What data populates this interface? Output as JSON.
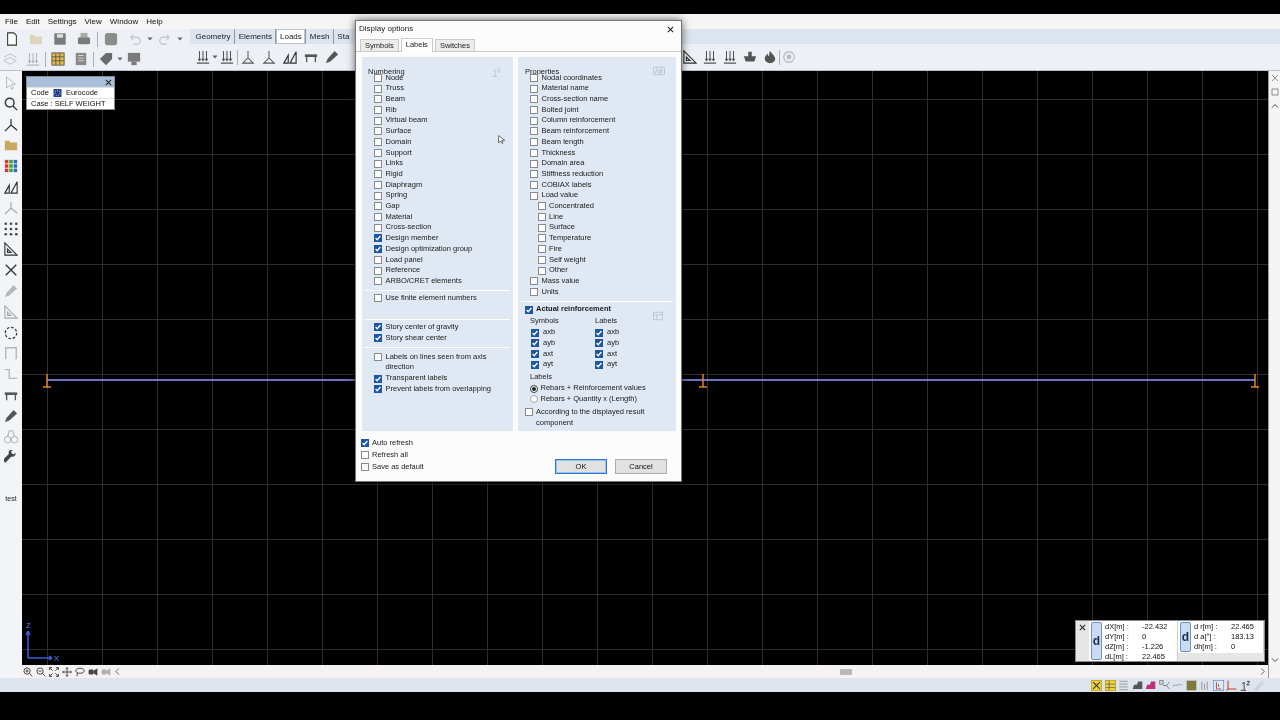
{
  "menu_bar": [
    "File",
    "Edit",
    "Settings",
    "View",
    "Window",
    "Help"
  ],
  "ribbon_tabs": [
    {
      "label": "Geometry",
      "selected": false
    },
    {
      "label": "Elements",
      "selected": false
    },
    {
      "label": "Loads",
      "selected": true
    },
    {
      "label": "Mesh",
      "selected": false
    },
    {
      "label": "Sta",
      "selected": false
    }
  ],
  "info_box": {
    "code_label": "Code",
    "code_value": "Eurocode",
    "case": "Case : SELF WEIGHT"
  },
  "dialog": {
    "title": "Display options",
    "tabs": [
      {
        "label": "Symbols",
        "selected": false
      },
      {
        "label": "Labels",
        "selected": true
      },
      {
        "label": "Switches",
        "selected": false
      }
    ],
    "numbering": {
      "heading": "Numbering",
      "items": [
        {
          "label": "Node",
          "checked": false
        },
        {
          "label": "Truss",
          "checked": false
        },
        {
          "label": "Beam",
          "checked": false
        },
        {
          "label": "Rib",
          "checked": false
        },
        {
          "label": "Virtual beam",
          "checked": false
        },
        {
          "label": "Surface",
          "checked": false
        },
        {
          "label": "Domain",
          "checked": false
        },
        {
          "label": "Support",
          "checked": false
        },
        {
          "label": "Links",
          "checked": false
        },
        {
          "label": "Rigid",
          "checked": false
        },
        {
          "label": "Diaphragm",
          "checked": false
        },
        {
          "label": "Spring",
          "checked": false
        },
        {
          "label": "Gap",
          "checked": false
        },
        {
          "label": "Material",
          "checked": false
        },
        {
          "label": "Cross-section",
          "checked": false
        },
        {
          "label": "Design member",
          "checked": true
        },
        {
          "label": "Design optimization group",
          "checked": true
        },
        {
          "label": "Load panel",
          "checked": false
        },
        {
          "label": "Reference",
          "checked": false
        },
        {
          "label": "ARBO/CRET elements",
          "checked": false
        }
      ],
      "finite_element": {
        "label": "Use finite element numbers",
        "checked": false
      },
      "story": [
        {
          "label": "Story center of gravity",
          "checked": true
        },
        {
          "label": "Story shear center",
          "checked": true
        }
      ],
      "display": [
        {
          "label": "Labels on lines seen from axis direction",
          "checked": false
        },
        {
          "label": "Transparent labels",
          "checked": true
        },
        {
          "label": "Prevent labels from overlapping",
          "checked": true
        }
      ]
    },
    "properties": {
      "heading": "Properties",
      "items": [
        {
          "label": "Nodal coordinates",
          "checked": false
        },
        {
          "label": "Material name",
          "checked": false
        },
        {
          "label": "Cross-section name",
          "checked": false
        },
        {
          "label": "Bolted joint",
          "checked": false
        },
        {
          "label": "Column reinforcement",
          "checked": false
        },
        {
          "label": "Beam reinforcement",
          "checked": false
        },
        {
          "label": "Beam length",
          "checked": false
        },
        {
          "label": "Thickness",
          "checked": false
        },
        {
          "label": "Domain area",
          "checked": false
        },
        {
          "label": "Stiffness reduction",
          "checked": false
        },
        {
          "label": "COBIAX labels",
          "checked": false
        },
        {
          "label": "Load value",
          "checked": false,
          "children": [
            {
              "label": "Concentrated",
              "checked": false
            },
            {
              "label": "Line",
              "checked": false
            },
            {
              "label": "Surface",
              "checked": false
            },
            {
              "label": "Temperature",
              "checked": false
            },
            {
              "label": "Fire",
              "checked": false
            },
            {
              "label": "Self weight",
              "checked": false
            },
            {
              "label": "Other",
              "checked": false
            }
          ]
        },
        {
          "label": "Mass value",
          "checked": false
        },
        {
          "label": "Units",
          "checked": false
        }
      ]
    },
    "actual_reinforcement": {
      "label": "Actual reinforcement",
      "checked": true,
      "symbols_heading": "Symbols",
      "labels_heading": "Labels",
      "symbols": [
        {
          "label": "axb",
          "checked": true
        },
        {
          "label": "ayb",
          "checked": true
        },
        {
          "label": "axt",
          "checked": true
        },
        {
          "label": "ayt",
          "checked": true
        }
      ],
      "labels": [
        {
          "label": "axb",
          "checked": true
        },
        {
          "label": "ayb",
          "checked": true
        },
        {
          "label": "axt",
          "checked": true
        },
        {
          "label": "ayt",
          "checked": true
        }
      ],
      "mode_heading": "Labels",
      "modes": [
        {
          "label": "Rebars + Reinforcement values",
          "selected": true
        },
        {
          "label": "Rebars + Quantity x (Length)",
          "selected": false
        }
      ],
      "result_component": {
        "label": "According to the displayed result component",
        "checked": false
      }
    },
    "options": [
      {
        "label": "Auto refresh",
        "checked": true
      },
      {
        "label": "Refresh all",
        "checked": false
      },
      {
        "label": "Save as default",
        "checked": false
      }
    ],
    "buttons": [
      {
        "label": "OK",
        "kind": "default"
      },
      {
        "label": "Cancel",
        "kind": "normal"
      }
    ]
  },
  "side_toolbar_label": "test",
  "viewport": {
    "axis_labels": {
      "z": "Z",
      "x": "X"
    }
  },
  "measure_box": {
    "groups": [
      {
        "letter": "d",
        "rows": [
          {
            "label": "dX[m] :",
            "value": "-22.432"
          },
          {
            "label": "dY[m] :",
            "value": "0"
          },
          {
            "label": "dZ[m] :",
            "value": "-1.226"
          },
          {
            "label": "dL[m] :",
            "value": "22.465"
          }
        ]
      },
      {
        "letter": "d",
        "rows": [
          {
            "label": "d r[m] :",
            "value": "22.465"
          },
          {
            "label": "d a[°] :",
            "value": "183.13"
          },
          {
            "label": "dh[m] :",
            "value": "0"
          }
        ]
      }
    ]
  }
}
